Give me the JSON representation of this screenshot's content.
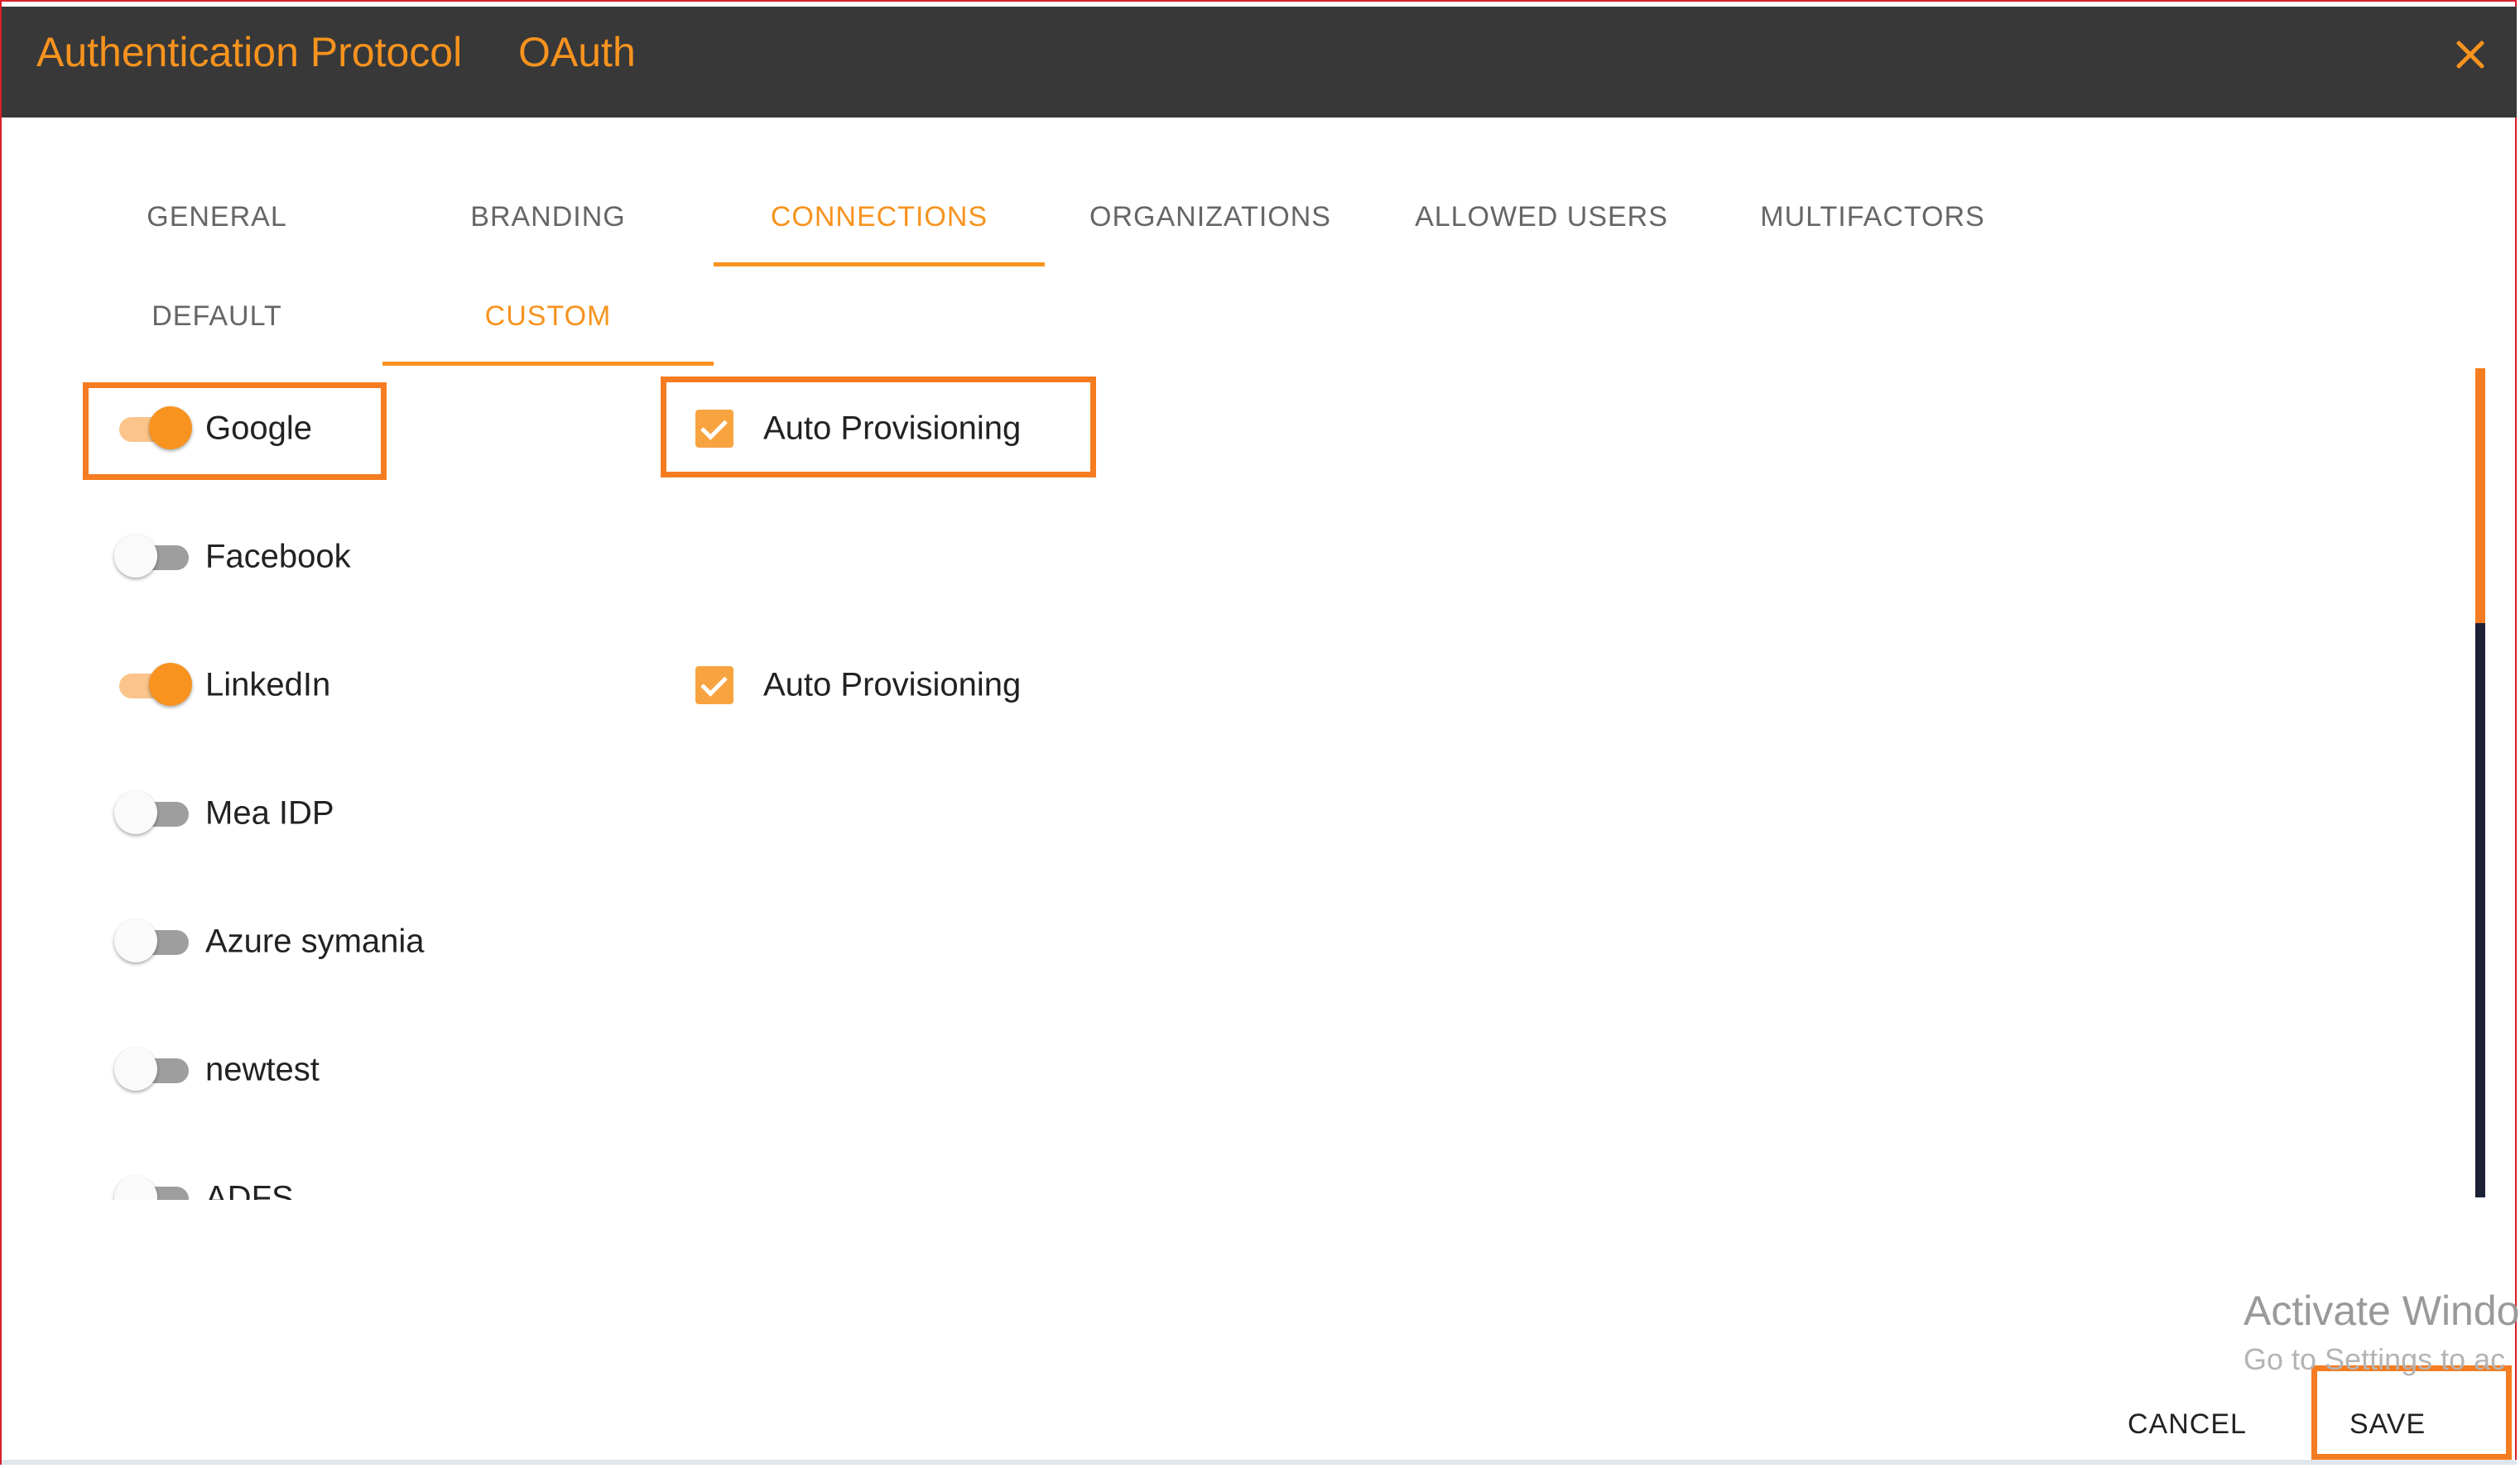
{
  "dialog": {
    "title": "Authentication Protocol",
    "protocol": "OAuth"
  },
  "tabs": [
    {
      "label": "GENERAL",
      "active": false
    },
    {
      "label": "BRANDING",
      "active": false
    },
    {
      "label": "CONNECTIONS",
      "active": true
    },
    {
      "label": "ORGANIZATIONS",
      "active": false
    },
    {
      "label": "ALLOWED USERS",
      "active": false
    },
    {
      "label": "MULTIFACTORS",
      "active": false
    }
  ],
  "subtabs": [
    {
      "label": "DEFAULT",
      "active": false
    },
    {
      "label": "CUSTOM",
      "active": true
    }
  ],
  "connections": [
    {
      "name": "Google",
      "enabled": true,
      "auto_provisioning": true,
      "auto_provisioning_label": "Auto Provisioning"
    },
    {
      "name": "Facebook",
      "enabled": false
    },
    {
      "name": "LinkedIn",
      "enabled": true,
      "auto_provisioning": true,
      "auto_provisioning_label": "Auto Provisioning"
    },
    {
      "name": "Mea IDP",
      "enabled": false
    },
    {
      "name": "Azure symania",
      "enabled": false
    },
    {
      "name": "newtest",
      "enabled": false
    },
    {
      "name": "ADFS",
      "enabled": false
    }
  ],
  "footer": {
    "cancel_label": "CANCEL",
    "save_label": "SAVE"
  },
  "watermark": {
    "line1": "Activate Windo",
    "line2": "Go to Settings to ac"
  },
  "colors": {
    "accent": "#f7931e",
    "titlebar": "#383838",
    "highlight": "#f57c20",
    "frame_border": "#d71f2b"
  }
}
